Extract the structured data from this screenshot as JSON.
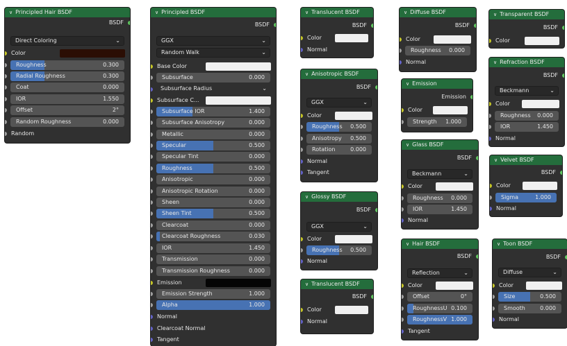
{
  "nodes": {
    "hair_principled": {
      "title": "Principled Hair BSDF",
      "output": "BSDF",
      "parametrization": "Direct Coloring",
      "color_label": "Color",
      "roughness": {
        "label": "Roughness",
        "value": "0.300",
        "fill": 0.3
      },
      "radial_roughness": {
        "label": "Radial Roughness",
        "value": "0.300",
        "fill": 0.3
      },
      "coat": {
        "label": "Coat",
        "value": "0.000"
      },
      "ior": {
        "label": "IOR",
        "value": "1.550"
      },
      "offset": {
        "label": "Offset",
        "value": "2°"
      },
      "random_roughness": {
        "label": "Random Roughness",
        "value": "0.000"
      },
      "random_label": "Random"
    },
    "principled": {
      "title": "Principled BSDF",
      "output": "BSDF",
      "distribution": "GGX",
      "subsurface_method": "Random Walk",
      "base_color_label": "Base Color",
      "subsurface": {
        "label": "Subsurface",
        "value": "0.000"
      },
      "subsurface_radius_label": "Subsurface Radius",
      "subsurface_color_label": "Subsurface C...",
      "subsurface_ior": {
        "label": "Subsurface IOR",
        "value": "1.400",
        "fill": 0.32
      },
      "subsurface_anisotropy": {
        "label": "Subsurface Anisotropy",
        "value": "0.000"
      },
      "metallic": {
        "label": "Metallic",
        "value": "0.000"
      },
      "specular": {
        "label": "Specular",
        "value": "0.500",
        "fill": 0.5
      },
      "specular_tint": {
        "label": "Specular Tint",
        "value": "0.000"
      },
      "roughness": {
        "label": "Roughness",
        "value": "0.500",
        "fill": 0.5
      },
      "anisotropic": {
        "label": "Anisotropic",
        "value": "0.000"
      },
      "anisotropic_rotation": {
        "label": "Anisotropic Rotation",
        "value": "0.000"
      },
      "sheen": {
        "label": "Sheen",
        "value": "0.000"
      },
      "sheen_tint": {
        "label": "Sheen Tint",
        "value": "0.500",
        "fill": 0.5
      },
      "clearcoat": {
        "label": "Clearcoat",
        "value": "0.000"
      },
      "clearcoat_roughness": {
        "label": "Clearcoat Roughness",
        "value": "0.030",
        "fill": 0.03
      },
      "ior": {
        "label": "IOR",
        "value": "1.450"
      },
      "transmission": {
        "label": "Transmission",
        "value": "0.000"
      },
      "transmission_roughness": {
        "label": "Transmission Roughness",
        "value": "0.000"
      },
      "emission_label": "Emission",
      "emission_strength": {
        "label": "Emission Strength",
        "value": "1.000"
      },
      "alpha": {
        "label": "Alpha",
        "value": "1.000",
        "fill": 1.0
      },
      "normal_label": "Normal",
      "clearcoat_normal_label": "Clearcoat Normal",
      "tangent_label": "Tangent"
    },
    "translucent1": {
      "title": "Translucent BSDF",
      "output": "BSDF",
      "color_label": "Color",
      "normal_label": "Normal"
    },
    "anisotropic": {
      "title": "Anisotropic BSDF",
      "output": "BSDF",
      "distribution": "GGX",
      "color_label": "Color",
      "roughness": {
        "label": "Roughness",
        "value": "0.500",
        "fill": 0.5
      },
      "anisotropy": {
        "label": "Anisotropy",
        "value": "0.500"
      },
      "rotation": {
        "label": "Rotation",
        "value": "0.000"
      },
      "normal_label": "Normal",
      "tangent_label": "Tangent"
    },
    "glossy": {
      "title": "Glossy BSDF",
      "output": "BSDF",
      "distribution": "GGX",
      "color_label": "Color",
      "roughness": {
        "label": "Roughness",
        "value": "0.500",
        "fill": 0.5
      },
      "normal_label": "Normal"
    },
    "translucent2": {
      "title": "Translucent BSDF",
      "output": "BSDF",
      "color_label": "Color",
      "normal_label": "Normal"
    },
    "diffuse": {
      "title": "Diffuse BSDF",
      "output": "BSDF",
      "color_label": "Color",
      "roughness": {
        "label": "Roughness",
        "value": "0.000"
      },
      "normal_label": "Normal"
    },
    "emission": {
      "title": "Emission",
      "output": "Emission",
      "color_label": "Color",
      "strength": {
        "label": "Strength",
        "value": "1.000"
      }
    },
    "glass": {
      "title": "Glass BSDF",
      "output": "BSDF",
      "distribution": "Beckmann",
      "color_label": "Color",
      "roughness": {
        "label": "Roughness",
        "value": "0.000"
      },
      "ior": {
        "label": "IOR",
        "value": "1.450"
      },
      "normal_label": "Normal"
    },
    "hair": {
      "title": "Hair BSDF",
      "output": "BSDF",
      "component": "Reflection",
      "color_label": "Color",
      "offset": {
        "label": "Offset",
        "value": "0°"
      },
      "roughness_u": {
        "label": "RoughnessU",
        "value": "0.100",
        "fill": 0.1
      },
      "roughness_v": {
        "label": "RoughnessV",
        "value": "1.000",
        "fill": 1.0
      },
      "tangent_label": "Tangent"
    },
    "transparent": {
      "title": "Transparent BSDF",
      "output": "BSDF",
      "color_label": "Color"
    },
    "refraction": {
      "title": "Refraction BSDF",
      "output": "BSDF",
      "distribution": "Beckmann",
      "color_label": "Color",
      "roughness": {
        "label": "Roughness",
        "value": "0.000"
      },
      "ior": {
        "label": "IOR",
        "value": "1.450"
      },
      "normal_label": "Normal"
    },
    "velvet": {
      "title": "Velvet BSDF",
      "output": "BSDF",
      "color_label": "Color",
      "sigma": {
        "label": "Sigma",
        "value": "1.000",
        "fill": 1.0
      },
      "normal_label": "Normal"
    },
    "toon": {
      "title": "Toon BSDF",
      "output": "BSDF",
      "component": "Diffuse",
      "color_label": "Color",
      "size": {
        "label": "Size",
        "value": "0.500",
        "fill": 0.5
      },
      "smooth": {
        "label": "Smooth",
        "value": "0.000"
      },
      "normal_label": "Normal"
    }
  },
  "colors": {
    "header_green": "#246d3c",
    "node_body": "#303030",
    "slider_fill": "#4772b3",
    "socket_shader": "#62c962",
    "socket_color": "#c7c729",
    "socket_float": "#a1a1a1",
    "socket_vector": "#6363c7"
  }
}
